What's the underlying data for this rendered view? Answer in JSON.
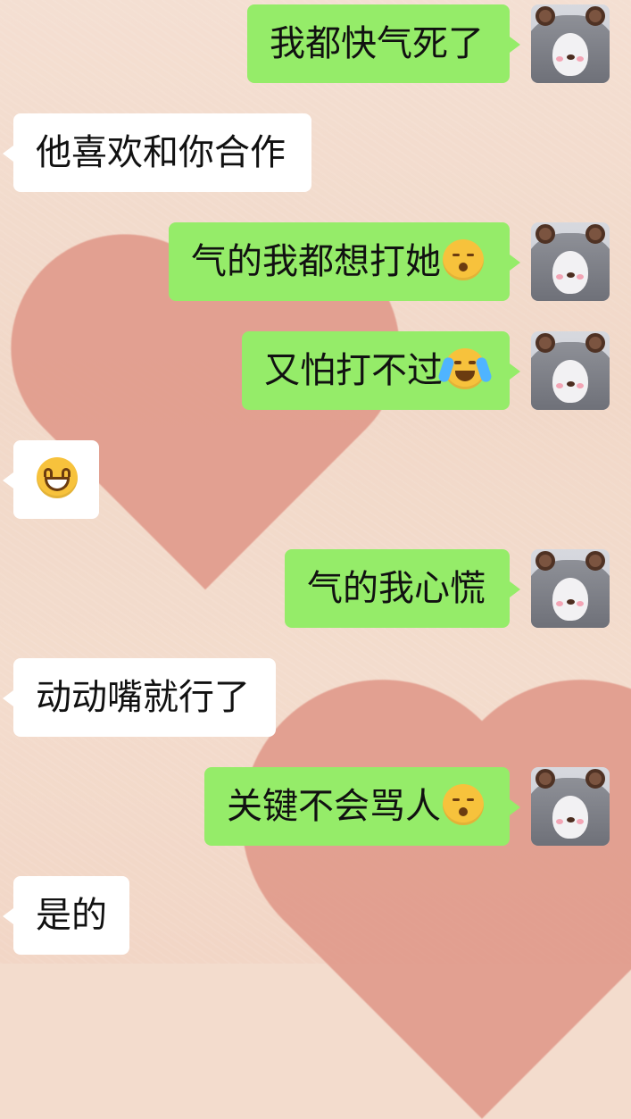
{
  "messages": [
    {
      "side": "out",
      "text": "我都快气死了"
    },
    {
      "side": "in",
      "text": "他喜欢和你合作"
    },
    {
      "side": "out",
      "text": "气的我都想打她",
      "emoji": "kissing-face-emoji"
    },
    {
      "side": "out",
      "text": "又怕打不过",
      "emoji": "loudly-crying-face-emoji"
    },
    {
      "side": "in",
      "text": "",
      "emoji": "grinning-face-emoji"
    },
    {
      "side": "out",
      "text": "气的我心慌"
    },
    {
      "side": "in",
      "text": "动动嘴就行了"
    },
    {
      "side": "out",
      "text": "关键不会骂人",
      "emoji": "kissing-face-emoji"
    },
    {
      "side": "in",
      "text": "是的"
    }
  ],
  "colors": {
    "outgoing_bubble": "#95ec69",
    "incoming_bubble": "#ffffff",
    "background": "#f3dccd"
  }
}
